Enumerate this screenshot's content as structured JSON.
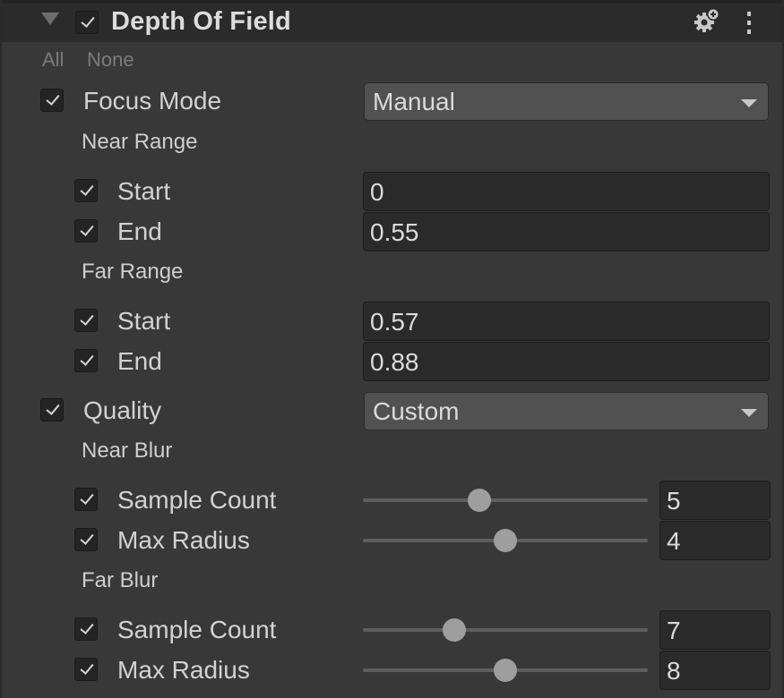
{
  "header": {
    "title": "Depth Of Field",
    "enabled": true,
    "icons": [
      "foldout-arrow",
      "gear-plus-icon",
      "more-vertical-icon"
    ]
  },
  "quick_select": {
    "all": "All",
    "none": "None"
  },
  "focus_mode": {
    "label": "Focus Mode",
    "value": "Manual"
  },
  "near_range": {
    "label": "Near Range",
    "start": {
      "label": "Start",
      "value": "0"
    },
    "end": {
      "label": "End",
      "value": "0.55"
    }
  },
  "far_range": {
    "label": "Far Range",
    "start": {
      "label": "Start",
      "value": "0.57"
    },
    "end": {
      "label": "End",
      "value": "0.88"
    }
  },
  "quality": {
    "label": "Quality",
    "value": "Custom"
  },
  "near_blur": {
    "label": "Near Blur",
    "sample_count": {
      "label": "Sample Count",
      "value": "5",
      "slider_fraction": 0.41
    },
    "max_radius": {
      "label": "Max Radius",
      "value": "4",
      "slider_fraction": 0.5
    }
  },
  "far_blur": {
    "label": "Far Blur",
    "sample_count": {
      "label": "Sample Count",
      "value": "7",
      "slider_fraction": 0.32
    },
    "max_radius": {
      "label": "Max Radius",
      "value": "8",
      "slider_fraction": 0.5
    }
  }
}
